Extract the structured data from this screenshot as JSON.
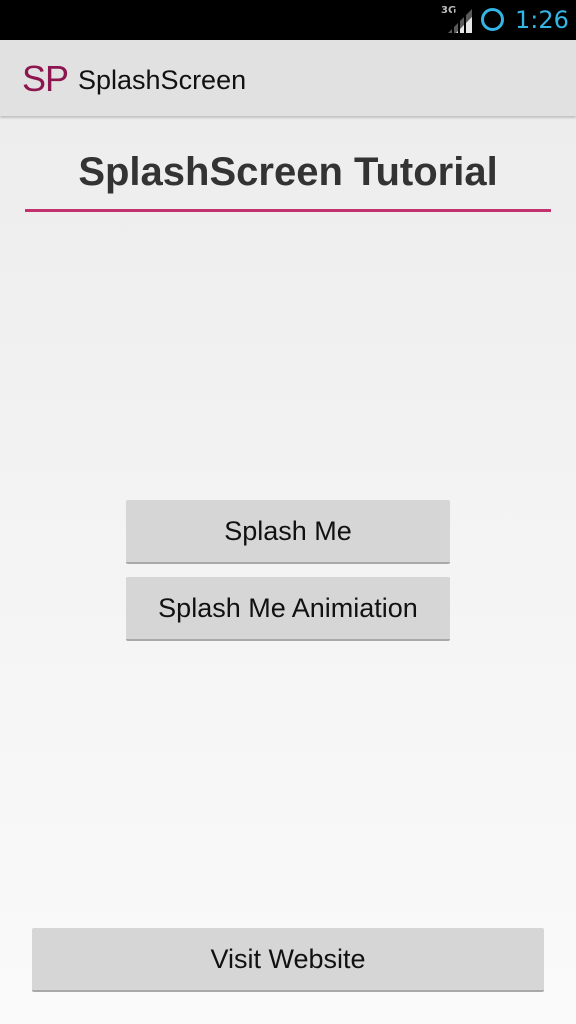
{
  "status_bar": {
    "network_type": "3G",
    "time": "1:26",
    "clock_color": "#33b5e5"
  },
  "action_bar": {
    "icon_text": "SP",
    "icon_color": "#8e1650",
    "title": "SplashScreen"
  },
  "main": {
    "heading": "SplashScreen Tutorial",
    "rule_color": "#c2326e",
    "buttons": {
      "splash_me": "Splash Me",
      "splash_me_animation": "Splash Me Animiation",
      "visit_website": "Visit Website"
    }
  }
}
